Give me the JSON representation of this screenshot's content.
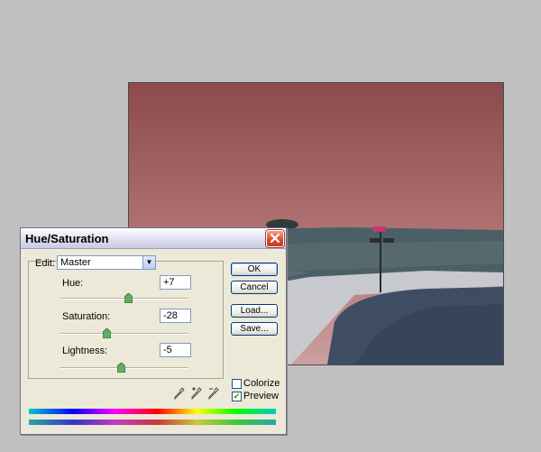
{
  "dialog": {
    "title": "Hue/Saturation",
    "edit_label": "Edit:",
    "edit_value": "Master",
    "hue": {
      "label": "Hue:",
      "value": "+7",
      "position": 0.52
    },
    "saturation": {
      "label": "Saturation:",
      "value": "-28",
      "position": 0.36
    },
    "lightness": {
      "label": "Lightness:",
      "value": "-5",
      "position": 0.48
    },
    "buttons": {
      "ok": "OK",
      "cancel": "Cancel",
      "load": "Load...",
      "save": "Save..."
    },
    "colorize": {
      "label": "Colorize",
      "checked": false
    },
    "preview": {
      "label": "Preview",
      "checked": true
    }
  },
  "colors": {
    "sky_top": "#8f4c4c",
    "sky_bottom": "#c98f8e",
    "ground": "#4a5a6a",
    "road": "#c9cbd1"
  }
}
